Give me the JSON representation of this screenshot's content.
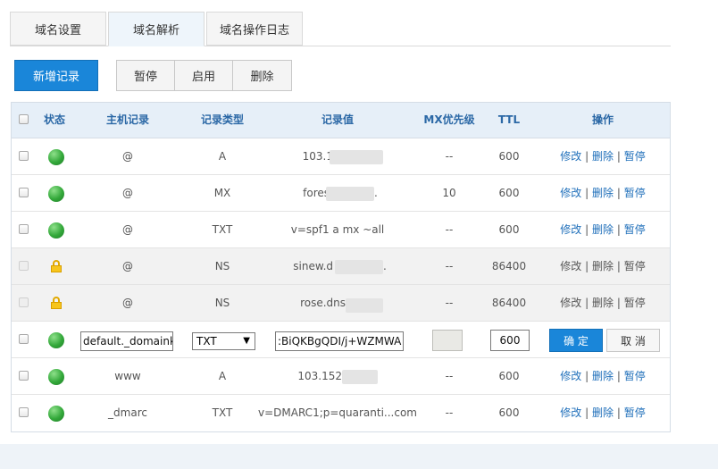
{
  "tabs": [
    {
      "label": "域名设置",
      "active": false
    },
    {
      "label": "域名解析",
      "active": true
    },
    {
      "label": "域名操作日志",
      "active": false
    }
  ],
  "toolbar": {
    "add_label": "新增记录",
    "pause_label": "暂停",
    "enable_label": "启用",
    "delete_label": "删除"
  },
  "table": {
    "headers": {
      "status": "状态",
      "host": "主机记录",
      "type": "记录类型",
      "value": "记录值",
      "mx": "MX优先级",
      "ttl": "TTL",
      "ops": "操作"
    },
    "op_labels": {
      "edit": "修改",
      "delete": "删除",
      "pause": "暂停",
      "sep": "|"
    },
    "rows": [
      {
        "status": "active",
        "host": "@",
        "type": "A",
        "value": "103.1",
        "mx": "--",
        "ttl": "600",
        "locked": false
      },
      {
        "status": "active",
        "host": "@",
        "type": "MX",
        "value": "fores",
        "value_suffix": ".",
        "mx": "10",
        "ttl": "600",
        "locked": false
      },
      {
        "status": "active",
        "host": "@",
        "type": "TXT",
        "value": "v=spf1 a mx ~all",
        "mx": "--",
        "ttl": "600",
        "locked": false
      },
      {
        "status": "locked",
        "host": "@",
        "type": "NS",
        "value": "sinew.d",
        "value_suffix": ".",
        "mx": "--",
        "ttl": "86400",
        "locked": true
      },
      {
        "status": "locked",
        "host": "@",
        "type": "NS",
        "value": "rose.dns",
        "mx": "--",
        "ttl": "86400",
        "locked": true
      },
      {
        "status": "active",
        "host": "www",
        "type": "A",
        "value": "103.152",
        "mx": "--",
        "ttl": "600",
        "locked": false
      },
      {
        "status": "active",
        "host": "_dmarc",
        "type": "TXT",
        "value": "v=DMARC1;p=quaranti...com",
        "mx": "--",
        "ttl": "600",
        "locked": false
      }
    ],
    "edit_row": {
      "host_value": "default._domaink",
      "type_selected": "TXT",
      "record_value": ":BiQKBgQDI/j+WZMWA",
      "ttl_value": "600",
      "confirm_label": "确 定",
      "cancel_label": "取 消"
    }
  },
  "colors": {
    "primary": "#1a86d9",
    "header_text": "#2b68a6",
    "link": "#1f6fba",
    "active_dot": "#33a83a",
    "lock": "#f7c51c"
  }
}
